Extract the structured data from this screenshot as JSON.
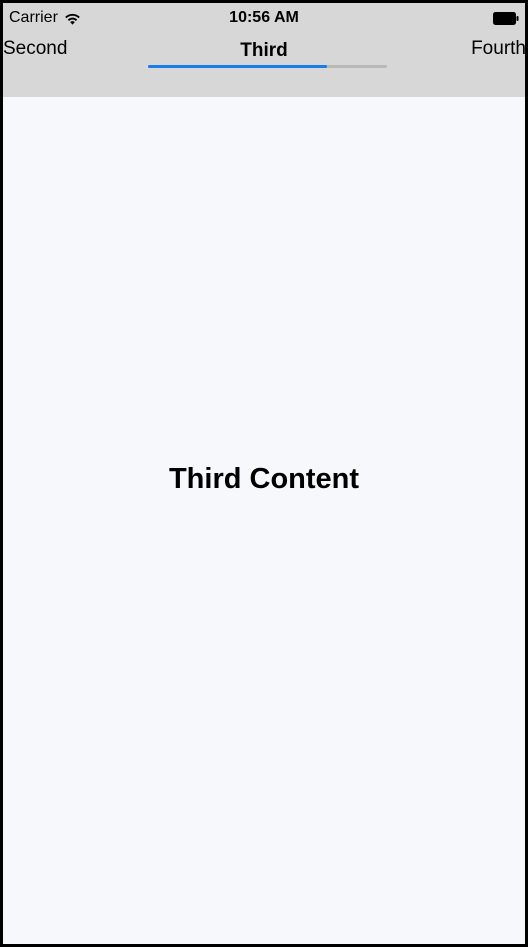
{
  "status_bar": {
    "carrier": "Carrier",
    "time": "10:56 AM",
    "wifi_icon": "wifi-icon",
    "battery_icon": "battery-icon"
  },
  "tabs": [
    {
      "label": "Second",
      "selected": false
    },
    {
      "label": "Third",
      "selected": true
    },
    {
      "label": "Fourth",
      "selected": false
    }
  ],
  "progress": {
    "fraction": 0.75
  },
  "content": {
    "title": "Third Content"
  },
  "colors": {
    "header_background": "#d7d7d7",
    "content_background": "#f7f8fc",
    "accent": "#1a7ee8",
    "track": "#b9b9b9"
  }
}
